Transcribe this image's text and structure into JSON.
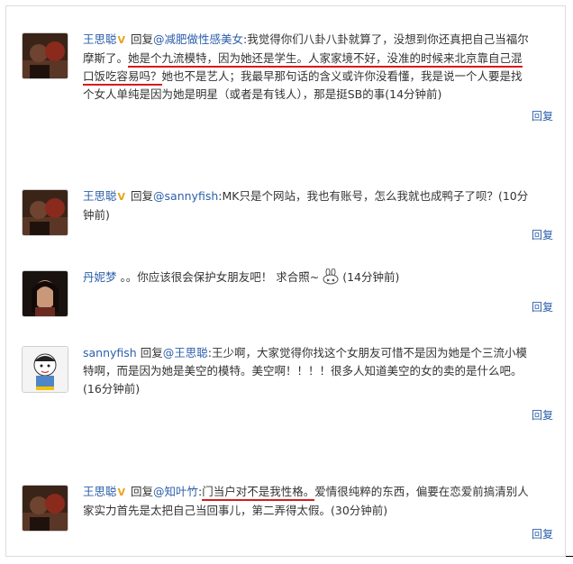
{
  "comments": [
    {
      "user": "王思聪",
      "v_badge": "V",
      "reply_label": "回复",
      "mention": "@减肥做性感美女",
      "text_a": ":我觉得你们八卦八卦就算了，没想到你还真把自己当福尔摩斯了。",
      "text_b": "她是个九流模特，因为她还是学生。人家家境不好，没准的时候来北京靠自己混口饭吃容易吗？",
      "text_c": "她也不是艺人；我最早那句话的含义或许你没看懂，我是说一个人要是找个女人单纯是因为她是明星（或者是有钱人），那是挺SB的事",
      "time": "(14分钟前)",
      "reply_button": "回复"
    },
    {
      "user": "王思聪",
      "v_badge": "V",
      "reply_label": "回复",
      "mention": "@sannyfish",
      "text_a": ":MK只是个网站，我也有账号，怎么我就也成鸭子了呗？",
      "time": "(10分钟前)",
      "reply_button": "回复"
    },
    {
      "user": "丹妮梦",
      "text_a": "。。你应该很会保护女朋友吧！ 求合照~",
      "emoticon": "rabbit-emoticon",
      "time": "(14分钟前)",
      "reply_button": "回复"
    },
    {
      "user": "sannyfish",
      "reply_label": "回复",
      "mention": "@王思聪",
      "text_a": ":王少啊，大家觉得你找这个女朋友可惜不是因为她是个三流小模特啊，而是因为她是美空的模特。美空啊！！！！很多人知道美空的女的卖的是什么吧。",
      "time": "(16分钟前)",
      "reply_button": "回复"
    },
    {
      "user": "王思聪",
      "v_badge": "V",
      "reply_label": "回复",
      "mention": "@知叶竹",
      "text_a": ":",
      "text_b": "门当户对不是我性格。",
      "text_c": "爱情很纯粹的东西，偏要在恋爱前搞清别人家实力首先是太把自己当回事儿，第二弄得太假。",
      "time": "(30分钟前)",
      "reply_button": "回复"
    }
  ],
  "colors": {
    "link": "#2b5faa",
    "verified": "#e8a31b",
    "underline": "#d61a1a",
    "text": "#333333"
  }
}
